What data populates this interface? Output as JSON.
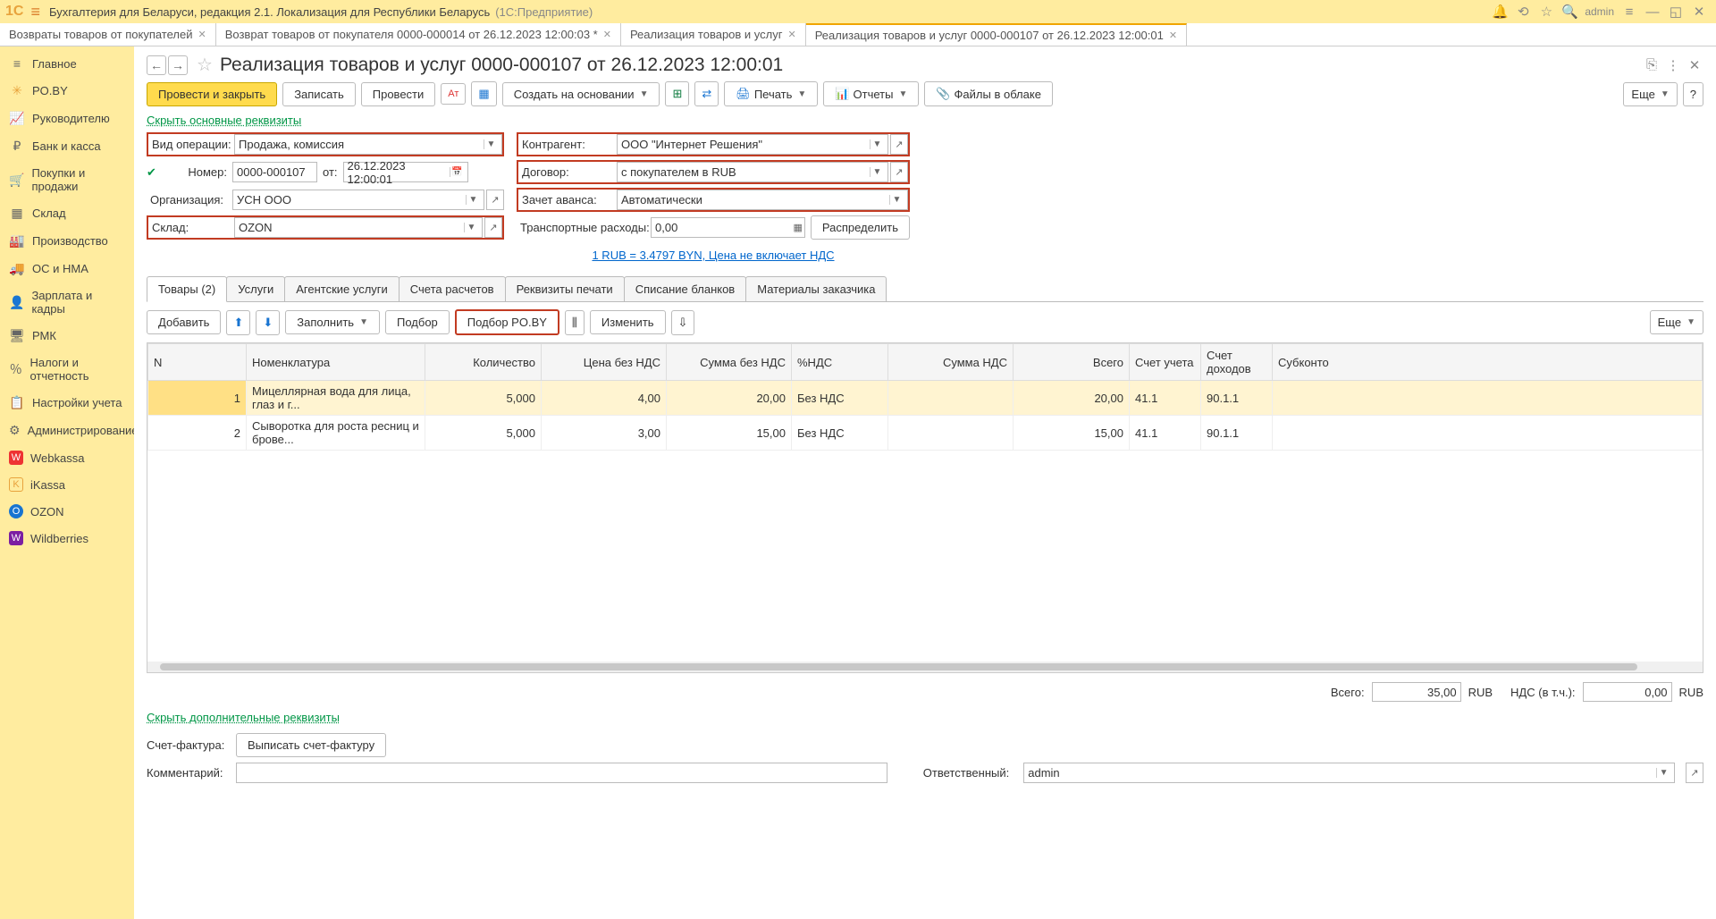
{
  "titlebar": {
    "logo": "1C",
    "title_main": "Бухгалтерия для Беларуси, редакция 2.1. Локализация для Республики Беларусь",
    "title_sub": "(1С:Предприятие)",
    "user": "admin"
  },
  "tabs": [
    {
      "label": "Возвраты товаров от покупателей",
      "active": false
    },
    {
      "label": "Возврат товаров от покупателя 0000-000014 от 26.12.2023 12:00:03 *",
      "active": false
    },
    {
      "label": "Реализация товаров и услуг",
      "active": false
    },
    {
      "label": "Реализация товаров и услуг 0000-000107 от 26.12.2023 12:00:01",
      "active": true
    }
  ],
  "sidebar": {
    "items": [
      {
        "label": "Главное",
        "icon": "≡"
      },
      {
        "label": "PO.BY",
        "icon": "✳"
      },
      {
        "label": "Руководителю",
        "icon": "📈"
      },
      {
        "label": "Банк и касса",
        "icon": "₽"
      },
      {
        "label": "Покупки и продажи",
        "icon": "🛒"
      },
      {
        "label": "Склад",
        "icon": "▦"
      },
      {
        "label": "Производство",
        "icon": "🏭"
      },
      {
        "label": "ОС и НМА",
        "icon": "🚚"
      },
      {
        "label": "Зарплата и кадры",
        "icon": "👤"
      },
      {
        "label": "РМК",
        "icon": "🖥"
      },
      {
        "label": "Налоги и отчетность",
        "icon": "％"
      },
      {
        "label": "Настройки учета",
        "icon": "📋"
      },
      {
        "label": "Администрирование",
        "icon": "⚙"
      },
      {
        "label": "Webkassa",
        "icon": "W"
      },
      {
        "label": "iKassa",
        "icon": "K"
      },
      {
        "label": "OZON",
        "icon": "O"
      },
      {
        "label": "Wildberries",
        "icon": "W"
      }
    ]
  },
  "doc": {
    "title": "Реализация товаров и услуг 0000-000107 от 26.12.2023 12:00:01",
    "toolbar": {
      "save_close": "Провести и закрыть",
      "write": "Записать",
      "post": "Провести",
      "create_based": "Создать на основании",
      "print": "Печать",
      "reports": "Отчеты",
      "cloud_files": "Файлы в облаке",
      "more": "Еще"
    },
    "hide_main": "Скрыть основные реквизиты",
    "fields": {
      "op_type_lbl": "Вид операции:",
      "op_type": "Продажа, комиссия",
      "number_lbl": "Номер:",
      "number": "0000-000107",
      "date_lbl": "от:",
      "date": "26.12.2023 12:00:01",
      "org_lbl": "Организация:",
      "org": "УСН ООО",
      "warehouse_lbl": "Склад:",
      "warehouse": "OZON",
      "counterparty_lbl": "Контрагент:",
      "counterparty": "ООО \"Интернет Решения\"",
      "contract_lbl": "Договор:",
      "contract": "с покупателем в RUB",
      "advance_lbl": "Зачет аванса:",
      "advance": "Автоматически",
      "transport_lbl": "Транспортные расходы:",
      "transport": "0,00",
      "distribute": "Распределить",
      "rate_link": "1 RUB = 3.4797 BYN,  Цена не включает НДС"
    },
    "inner_tabs": [
      "Товары (2)",
      "Услуги",
      "Агентские услуги",
      "Счета расчетов",
      "Реквизиты печати",
      "Списание бланков",
      "Материалы заказчика"
    ],
    "table_tb": {
      "add": "Добавить",
      "fill": "Заполнить",
      "pick": "Подбор",
      "pick_poby": "Подбор PO.BY",
      "change": "Изменить",
      "more": "Еще"
    },
    "grid": {
      "headers": [
        "N",
        "Номенклатура",
        "Количество",
        "Цена без НДС",
        "Сумма без НДС",
        "%НДС",
        "Сумма НДС",
        "Всего",
        "Счет учета",
        "Счет доходов",
        "Субконто"
      ],
      "rows": [
        {
          "n": "1",
          "nom": "Мицеллярная вода для лица, глаз и г...",
          "qty": "5,000",
          "price": "4,00",
          "sum": "20,00",
          "vat": "Без НДС",
          "vatsum": "",
          "total": "20,00",
          "acc": "41.1",
          "inc": "90.1.1",
          "sub": ""
        },
        {
          "n": "2",
          "nom": "Сыворотка для роста ресниц и брове...",
          "qty": "5,000",
          "price": "3,00",
          "sum": "15,00",
          "vat": "Без НДС",
          "vatsum": "",
          "total": "15,00",
          "acc": "41.1",
          "inc": "90.1.1",
          "sub": ""
        }
      ]
    },
    "totals": {
      "total_lbl": "Всего:",
      "total": "35,00",
      "cur1": "RUB",
      "vat_incl_lbl": "НДС (в т.ч.):",
      "vat_incl": "0,00",
      "cur2": "RUB"
    },
    "hide_extra": "Скрыть дополнительные реквизиты",
    "invoice_lbl": "Счет-фактура:",
    "invoice_btn": "Выписать счет-фактуру",
    "comment_lbl": "Комментарий:",
    "comment": "",
    "responsible_lbl": "Ответственный:",
    "responsible": "admin"
  }
}
